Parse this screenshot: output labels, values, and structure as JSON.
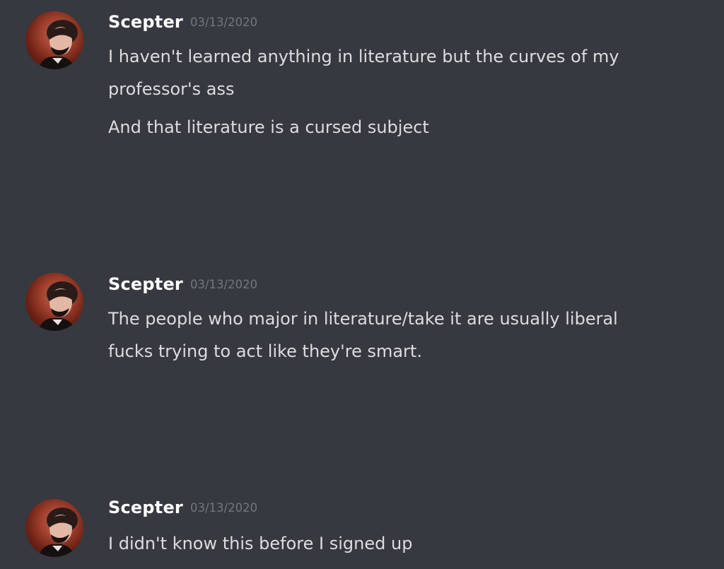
{
  "chat": {
    "messages": [
      {
        "author": "Scepter",
        "timestamp": "03/13/2020",
        "avatar_icon": "portrait-avatar-icon",
        "lines": [
          "I haven't learned anything in literature but the curves of my",
          "professor's ass",
          "And that literature is a cursed subject"
        ]
      },
      {
        "author": "Scepter",
        "timestamp": "03/13/2020",
        "avatar_icon": "portrait-avatar-icon",
        "lines": [
          "The people who major in literature/take it are usually liberal",
          "fucks trying to act like they're smart."
        ]
      },
      {
        "author": "Scepter",
        "timestamp": "03/13/2020",
        "avatar_icon": "portrait-avatar-icon",
        "lines": [
          "I didn't know this before I signed up"
        ]
      }
    ]
  },
  "colors": {
    "background": "#36393f",
    "username": "#ffffff",
    "message_text": "#dcddde",
    "timestamp": "#72767d",
    "avatar_accent": "#a0402e"
  }
}
